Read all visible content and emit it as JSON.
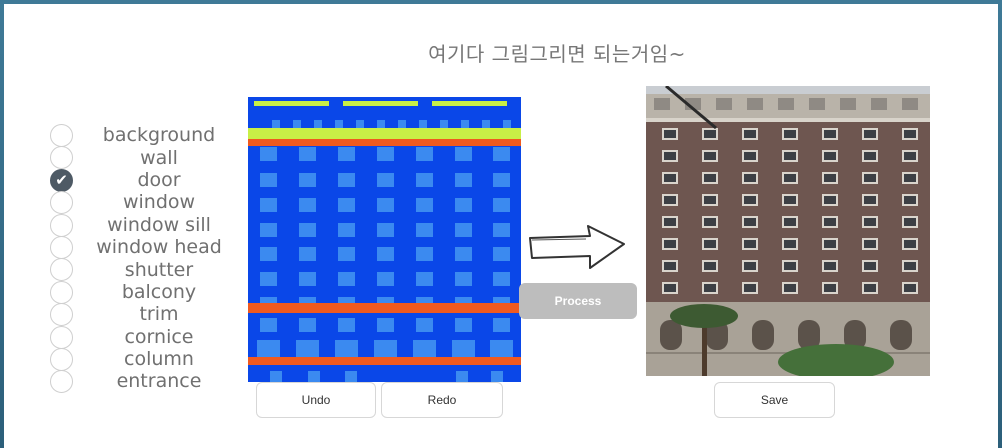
{
  "headline": "여기다 그림그리면 되는거임~",
  "labels": [
    {
      "text": "background",
      "checked": false
    },
    {
      "text": "wall",
      "checked": false
    },
    {
      "text": "door",
      "checked": true
    },
    {
      "text": "window",
      "checked": false
    },
    {
      "text": "window sill",
      "checked": false
    },
    {
      "text": "window head",
      "checked": false
    },
    {
      "text": "shutter",
      "checked": false
    },
    {
      "text": "balcony",
      "checked": false
    },
    {
      "text": "trim",
      "checked": false
    },
    {
      "text": "cornice",
      "checked": false
    },
    {
      "text": "column",
      "checked": false
    },
    {
      "text": "entrance",
      "checked": false
    }
  ],
  "buttons": {
    "undo": "Undo",
    "redo": "Redo",
    "process": "Process",
    "save": "Save"
  },
  "colors": {
    "wall": "#0a47e8",
    "window": "#3b8af0",
    "cornice": "#c8f046",
    "trim": "#f05a1e",
    "background_frame": "#3f7a97",
    "brick": "#6e5650"
  }
}
